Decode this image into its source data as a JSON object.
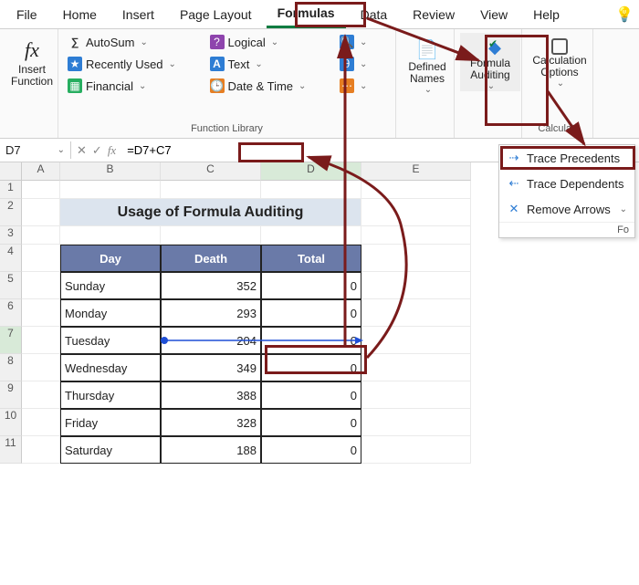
{
  "tabs": [
    "File",
    "Home",
    "Insert",
    "Page Layout",
    "Formulas",
    "Data",
    "Review",
    "View",
    "Help"
  ],
  "active_tab": "Formulas",
  "ribbon": {
    "insert_function": "Insert\nFunction",
    "library": {
      "autosum": "AutoSum",
      "recent": "Recently Used",
      "financial": "Financial",
      "logical": "Logical",
      "text": "Text",
      "datetime": "Date & Time",
      "group_label": "Function Library"
    },
    "defined_names": "Defined\nNames",
    "formula_auditing": "Formula\nAuditing",
    "calc_options": "Calculation\nOptions",
    "calc_group": "Calculati"
  },
  "dropdown": {
    "trace_precedents": "Trace Precedents",
    "trace_dependents": "Trace Dependents",
    "remove_arrows": "Remove Arrows",
    "group": "Fo"
  },
  "namebox": "D7",
  "formula": "=D7+C7",
  "colheaders": [
    "A",
    "B",
    "C",
    "D",
    "E"
  ],
  "rowheaders": [
    "1",
    "2",
    "3",
    "4",
    "5",
    "6",
    "7",
    "8",
    "9",
    "10",
    "11"
  ],
  "title": "Usage of Formula Auditing",
  "table": {
    "headers": [
      "Day",
      "Death",
      "Total"
    ],
    "rows": [
      {
        "day": "Sunday",
        "death": "352",
        "total": "0"
      },
      {
        "day": "Monday",
        "death": "293",
        "total": "0"
      },
      {
        "day": "Tuesday",
        "death": "204",
        "total": "0"
      },
      {
        "day": "Wednesday",
        "death": "349",
        "total": "0"
      },
      {
        "day": "Thursday",
        "death": "388",
        "total": "0"
      },
      {
        "day": "Friday",
        "death": "328",
        "total": "0"
      },
      {
        "day": "Saturday",
        "death": "188",
        "total": "0"
      }
    ]
  }
}
